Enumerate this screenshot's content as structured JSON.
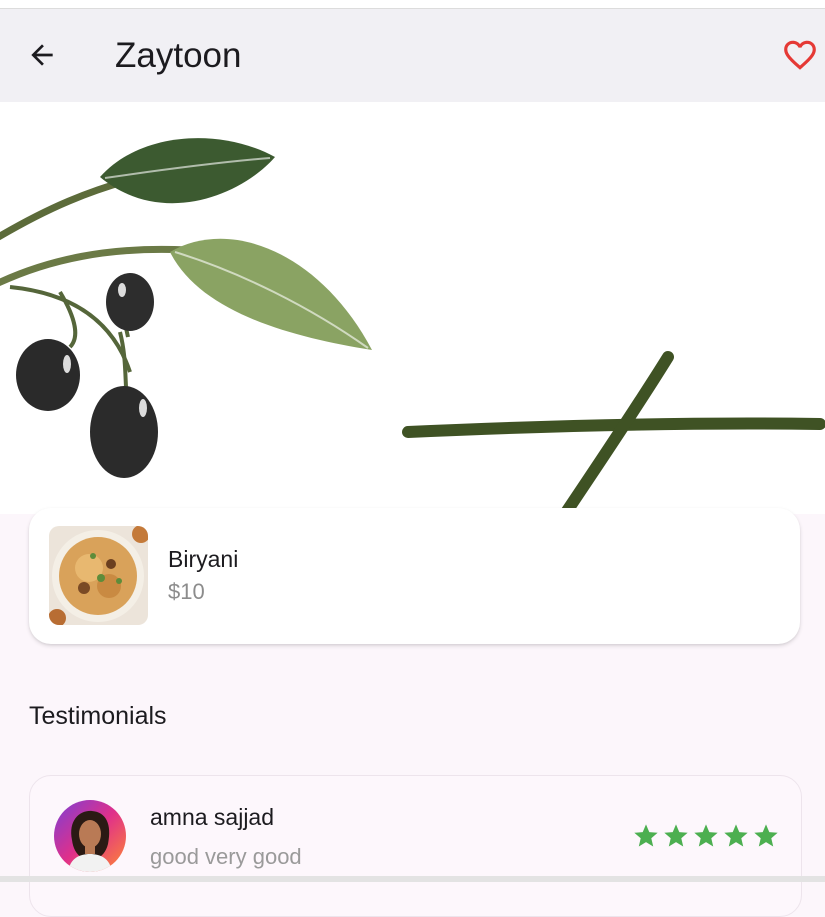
{
  "app_bar": {
    "title": "Zaytoon",
    "back_icon": "arrow-left-icon",
    "favorite_icon": "heart-outline-icon",
    "favorite_color": "#e53935"
  },
  "hero": {
    "image": "olive-branch-logo-banner"
  },
  "menu_items": [
    {
      "name": "Biryani",
      "price": "$10",
      "image": "biryani-plate-image"
    }
  ],
  "testimonials": {
    "title": "Testimonials",
    "items": [
      {
        "name": "amna sajjad",
        "text": "good very good",
        "rating": 5,
        "avatar": "woman-avatar-image"
      }
    ]
  },
  "colors": {
    "star": "#4caf50",
    "app_bar_bg": "#f1f0f4",
    "page_bg": "#fcf6fb"
  }
}
